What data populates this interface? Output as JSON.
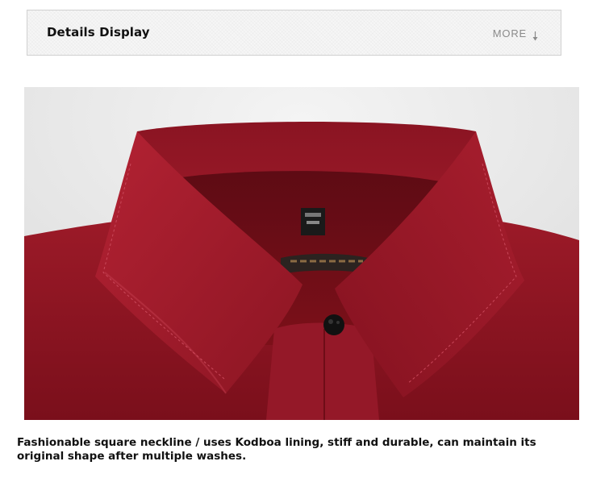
{
  "header": {
    "title": "Details Display",
    "more_label": "MORE",
    "more_icon": "arrow-down-icon"
  },
  "photo": {
    "subject": "shirt-collar-photo",
    "shirt_color": "#8e1623",
    "background_color": "#ececec"
  },
  "caption": {
    "text": "Fashionable square neckline / uses Kodboa lining, stiff and durable, can maintain its original shape after multiple washes."
  }
}
